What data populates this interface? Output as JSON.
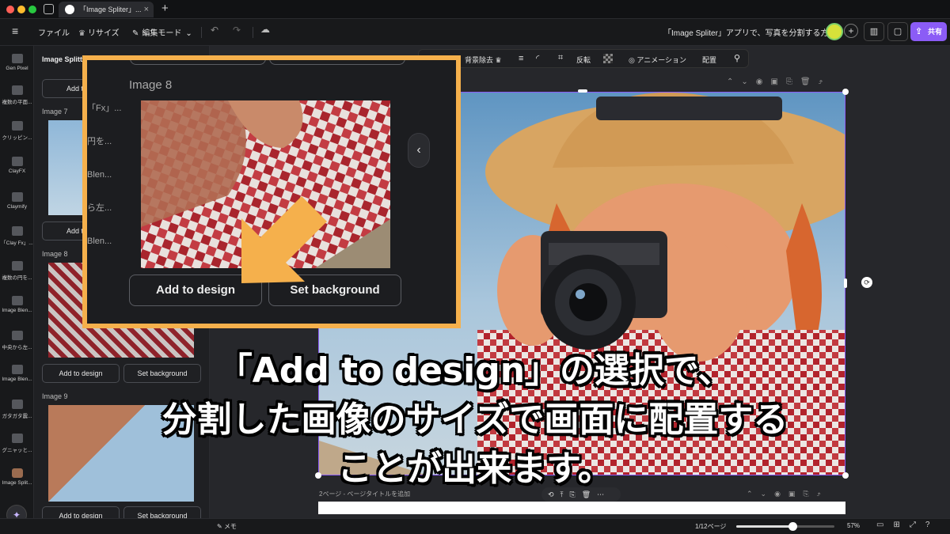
{
  "tab": {
    "title": "「Image Spliter」..."
  },
  "toolbar": {
    "file": "ファイル",
    "resize": "リサイズ",
    "edit_mode": "編集モード",
    "doc_title": "「Image Spliter」アプリで、写真を分割する方法",
    "share": "共有"
  },
  "context_toolbar": {
    "bg_remove": "背景除去",
    "flip": "反転",
    "animation": "アニメーション",
    "position": "配置"
  },
  "rail": [
    {
      "label": "Gen Pixel"
    },
    {
      "label": "複数の平面..."
    },
    {
      "label": "クリッピン..."
    },
    {
      "label": "ClayFX"
    },
    {
      "label": "Claymify"
    },
    {
      "label": "「Clay Fx」..."
    },
    {
      "label": "複数の円を..."
    },
    {
      "label": "Image Blen..."
    },
    {
      "label": "中央から左..."
    },
    {
      "label": "Image Blen..."
    },
    {
      "label": "ガタガタ震..."
    },
    {
      "label": "グニャッと..."
    },
    {
      "label": "Image Split..."
    },
    {
      "label": "Magic"
    }
  ],
  "panel": {
    "title": "Image Splitt...",
    "image7": "Image 7",
    "image8": "Image 8",
    "image9": "Image 9",
    "add_label": "Add to",
    "add_to_design": "Add to design",
    "set_background": "Set background"
  },
  "zoom": {
    "image_label": "Image 8",
    "add_to_design": "Add to design",
    "set_background": "Set background",
    "side_texts": [
      "「Fx」...",
      "円を...",
      "Blen...",
      "ら左...",
      "Blen..."
    ]
  },
  "canvas": {
    "page_label": "2ページ - ページタイトルを追加"
  },
  "bottombar": {
    "memo": "メモ",
    "page_indicator": "1/12ページ",
    "zoom_level": "57%",
    "zoom_fraction": 0.57
  },
  "caption": {
    "line1": "「Add to design」の選択で、",
    "line2": "分割した画像のサイズで画面に配置する",
    "line3": "ことが出来ます。"
  },
  "colors": {
    "accent": "#8b5cf6",
    "highlight": "#f5b04c",
    "arrow": "#f5b04c"
  }
}
